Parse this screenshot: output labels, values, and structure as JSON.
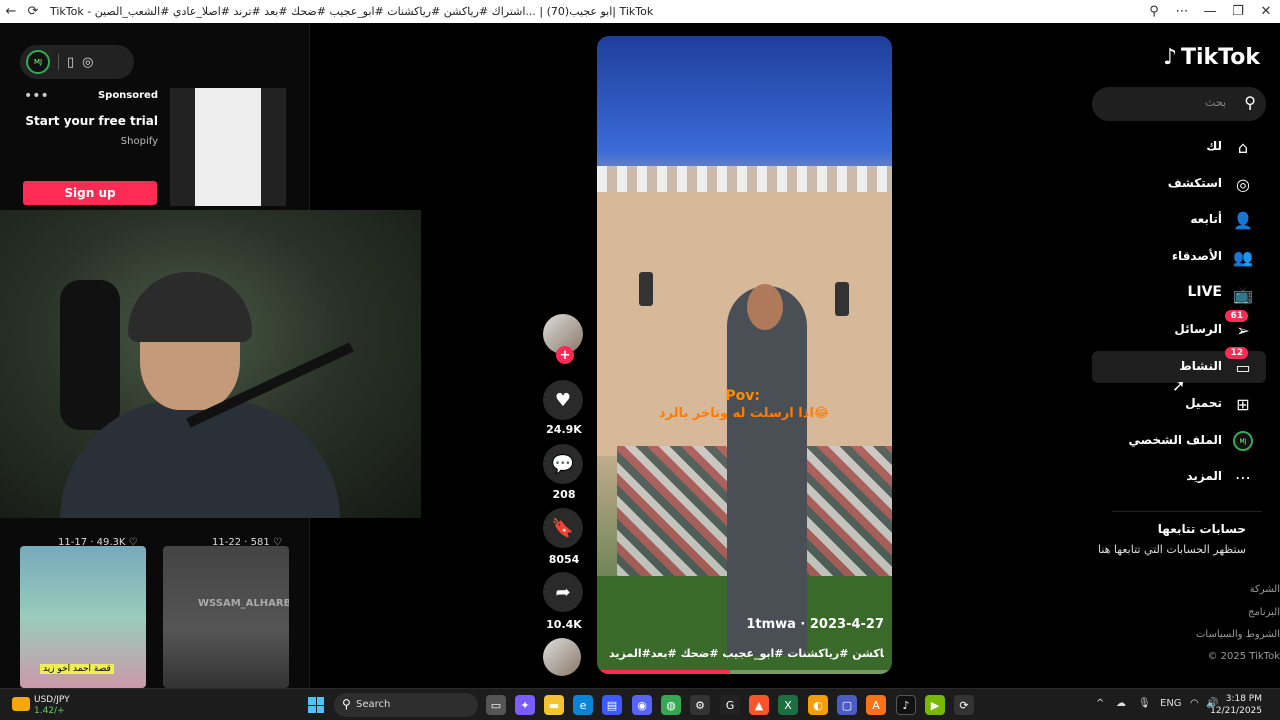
{
  "browser": {
    "title": "TikTok - ابو عجيب(70) | ...اشتراك #رياكشن #رياكشنات #ابو_عجيب #ضحك #بعد #ترند #اصلا_عادي #الشعب_الصين| TikTok",
    "back_icon": "arrow-left-icon",
    "reload_icon": "reload-icon",
    "zoom_icon": "zoom-icon",
    "more_icon": "more-icon",
    "minimize": "—",
    "maximize": "❐",
    "close": "✕"
  },
  "left_panel": {
    "avatar_text": "MJ",
    "ad": {
      "dots": "•••",
      "sponsored": "Sponsored",
      "title": "Start your free trial",
      "brand": "Shopify",
      "cta": "Sign up"
    },
    "stats": [
      {
        "text": "11-17 · 49.3K ♡"
      },
      {
        "text": "11-22 · 581 ♡"
      }
    ],
    "thumbs": [
      {
        "caption": "قصة احمد اخو زيد"
      },
      {
        "overlay": "WSSAM_ALHARBI"
      }
    ]
  },
  "video": {
    "pov": "Pov:",
    "caption": "اذا ارسلت له وتاخر بالرد😂",
    "author_date": "1tmwa · 2023-4-27",
    "hashtags": "#رياكشن #رياكشنات #ابو_عجيب #ضحك #بعد...",
    "more": "المزيد",
    "progress": 0.45
  },
  "actions": {
    "likes": "24.9K",
    "comments": "208",
    "saves": "8054",
    "shares": "10.4K",
    "follow_plus": "+"
  },
  "sidebar": {
    "logo": "TikTok",
    "search_placeholder": "بحث",
    "items": [
      {
        "label": "لك",
        "icon": "home-icon"
      },
      {
        "label": "استكشف",
        "icon": "compass-icon"
      },
      {
        "label": "أتابعه",
        "icon": "user-follow-icon"
      },
      {
        "label": "الأصدقاء",
        "icon": "friends-icon"
      },
      {
        "label": "LIVE",
        "icon": "live-icon"
      },
      {
        "label": "الرسائل",
        "icon": "messages-icon",
        "badge": "61"
      },
      {
        "label": "النشاط",
        "icon": "activity-icon",
        "badge": "12"
      },
      {
        "label": "تحميل",
        "icon": "upload-icon"
      },
      {
        "label": "الملف الشخصي",
        "icon": "profile-icon"
      },
      {
        "label": "المزيد",
        "icon": "more-icon"
      }
    ],
    "following_title": "حسابات تتابعها",
    "following_sub": "ستظهر الحسابات التي تتابعها هنا",
    "footer": [
      "الشركة",
      "البرنامج",
      "الشروط والسياسات",
      "© 2025 TikTok"
    ]
  },
  "taskbar": {
    "symbol": "USD/JPY",
    "change": "1.42/+",
    "search": "Search",
    "lang": "ENG",
    "time": "3:18 PM",
    "date": "12/21/2025"
  },
  "colors": {
    "accent": "#fe2c55",
    "background": "#000000"
  }
}
